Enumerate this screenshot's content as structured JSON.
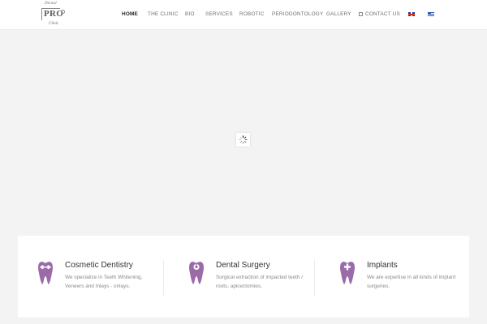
{
  "header": {
    "logo": {
      "top": "Dental",
      "mid": "PRO",
      "bottom": "Clinic"
    },
    "nav": [
      {
        "label": "HOME",
        "active": true
      },
      {
        "label": "THE CLINIC"
      },
      {
        "label": "BIO"
      },
      {
        "label": "SERVICES"
      },
      {
        "label": "ROBOTIC"
      },
      {
        "label": "PERIODONTOLOGY"
      },
      {
        "label": "GALLERY"
      },
      {
        "label": "CONTACT US",
        "icon": "calendar-icon"
      }
    ],
    "languages": [
      {
        "icon": "uk-flag-icon"
      },
      {
        "icon": "greek-flag-icon"
      }
    ]
  },
  "loader": {
    "icon": "spinner-icon"
  },
  "features": [
    {
      "icon": "tooth-braces-icon",
      "title": "Cosmetic Dentistry",
      "description": "We specialize in Teeth Whitening, Veneers and Inlays - onlays."
    },
    {
      "icon": "tooth-tool-icon",
      "title": "Dental Surgery",
      "description": "Surgical extraction of impacted teeth / roots, apicectomies."
    },
    {
      "icon": "tooth-plus-icon",
      "title": "Implants",
      "description": "We are expertise in all kinds of implant surgeries."
    }
  ],
  "colors": {
    "accent": "#9b6aa9",
    "background": "#f3f3f3",
    "text_dark": "#333333",
    "text_muted": "#8a8a8a"
  }
}
